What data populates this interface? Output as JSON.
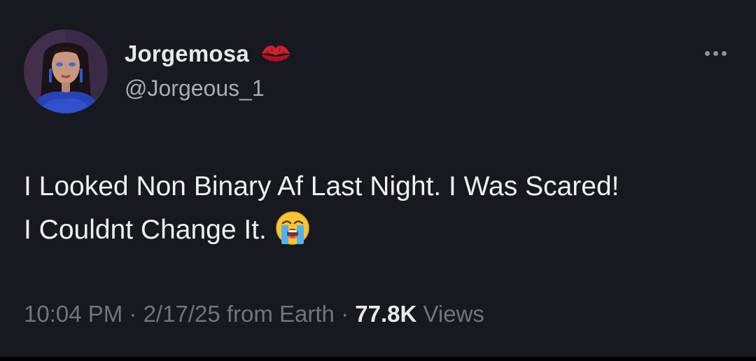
{
  "author": {
    "display_name": "Jorgemosa",
    "handle": "@Jorgeous_1",
    "name_emoji": "kiss-mark-icon",
    "avatar": "profile-avatar"
  },
  "tweet": {
    "line1": "I Looked Non Binary Af Last Night. I Was Scared!",
    "line2": "I Couldnt Change It.",
    "emoji": "loudly-crying-face-icon"
  },
  "meta": {
    "time": "10:04 PM",
    "sep1": " · ",
    "date": "2/17/25",
    "source": " from Earth",
    "sep2": " · ",
    "views_count": "77.8K",
    "views_label": " Views"
  },
  "more_menu": {
    "icon": "more-horizontal-icon"
  },
  "colors": {
    "background": "#16191f",
    "text_primary": "#e7e9ea",
    "text_secondary": "#6f767e"
  }
}
